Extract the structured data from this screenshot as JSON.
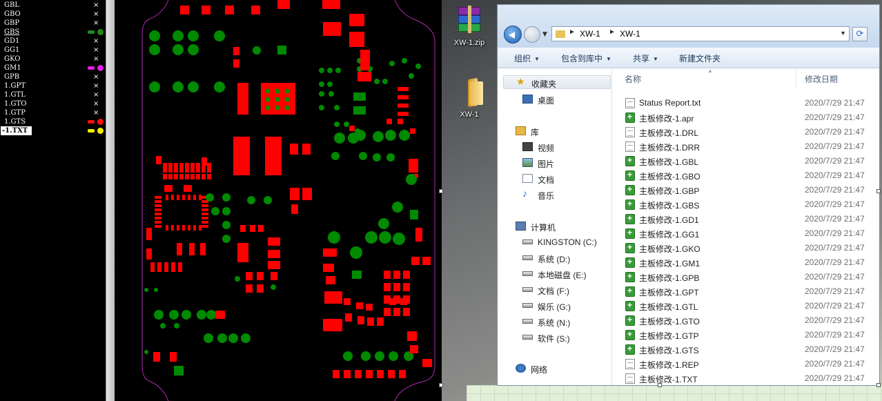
{
  "layer_panel": {
    "layers": [
      {
        "name": "GBL",
        "visible_mark": "×",
        "color": null
      },
      {
        "name": "GBO",
        "visible_mark": "×",
        "color": null
      },
      {
        "name": "GBP",
        "visible_mark": "×",
        "color": null
      },
      {
        "name": "GBS",
        "visible_mark": null,
        "color": "#1d8a1d",
        "underline": true
      },
      {
        "name": "GD1",
        "visible_mark": "×",
        "color": null
      },
      {
        "name": "GG1",
        "visible_mark": "×",
        "color": null
      },
      {
        "name": "GKO",
        "visible_mark": "×",
        "color": null
      },
      {
        "name": "GM1",
        "visible_mark": null,
        "color": "#e020e0"
      },
      {
        "name": "GPB",
        "visible_mark": "×",
        "color": null
      },
      {
        "name": "1.GPT",
        "visible_mark": "×",
        "color": null
      },
      {
        "name": "1.GTL",
        "visible_mark": "×",
        "color": null
      },
      {
        "name": "1.GTO",
        "visible_mark": "×",
        "color": null
      },
      {
        "name": "1.GTP",
        "visible_mark": "×",
        "color": null
      },
      {
        "name": "1.GTS",
        "visible_mark": null,
        "color": "#ff1010"
      },
      {
        "name": "-1.TXT",
        "visible_mark": null,
        "color": "#f3f000",
        "selected": true
      }
    ]
  },
  "pcb": {
    "outline_color": "#b028b0",
    "pad_red": "#ff0000",
    "pad_green": "#008a00"
  },
  "desktop": {
    "icons": [
      {
        "label": "XW-1.zip",
        "icon": "winrar-archive-icon"
      },
      {
        "label": "XW-1",
        "icon": "folder-icon"
      }
    ]
  },
  "explorer": {
    "address": {
      "crumbs": [
        "XW-1",
        "XW-1"
      ]
    },
    "toolbar": {
      "organize": "组织",
      "include_in_library": "包含到库中",
      "share": "共享",
      "new_folder": "新建文件夹"
    },
    "nav": {
      "favorites": "收藏夹",
      "desktop": "桌面",
      "libraries": "库",
      "videos": "视频",
      "pictures": "图片",
      "documents": "文档",
      "music": "音乐",
      "computer": "计算机",
      "drives": [
        "KINGSTON (C:)",
        "系统 (D:)",
        "本地磁盘 (E:)",
        "文档 (F:)",
        "娱乐 (G:)",
        "系统 (N:)",
        "软件 (S:)"
      ],
      "network": "网络"
    },
    "columns": {
      "name": "名称",
      "modified": "修改日期"
    },
    "files": [
      {
        "name": "Status Report.txt",
        "date": "2020/7/29 21:47",
        "icon": "text-file-icon"
      },
      {
        "name": "主板修改-1.apr",
        "date": "2020/7/29 21:47",
        "icon": "gerber-file-icon"
      },
      {
        "name": "主板修改-1.DRL",
        "date": "2020/7/29 21:47",
        "icon": "text-file-icon"
      },
      {
        "name": "主板修改-1.DRR",
        "date": "2020/7/29 21:47",
        "icon": "text-file-icon"
      },
      {
        "name": "主板修改-1.GBL",
        "date": "2020/7/29 21:47",
        "icon": "gerber-file-icon"
      },
      {
        "name": "主板修改-1.GBO",
        "date": "2020/7/29 21:47",
        "icon": "gerber-file-icon"
      },
      {
        "name": "主板修改-1.GBP",
        "date": "2020/7/29 21:47",
        "icon": "gerber-file-icon"
      },
      {
        "name": "主板修改-1.GBS",
        "date": "2020/7/29 21:47",
        "icon": "gerber-file-icon"
      },
      {
        "name": "主板修改-1.GD1",
        "date": "2020/7/29 21:47",
        "icon": "gerber-file-icon"
      },
      {
        "name": "主板修改-1.GG1",
        "date": "2020/7/29 21:47",
        "icon": "gerber-file-icon"
      },
      {
        "name": "主板修改-1.GKO",
        "date": "2020/7/29 21:47",
        "icon": "gerber-file-icon"
      },
      {
        "name": "主板修改-1.GM1",
        "date": "2020/7/29 21:47",
        "icon": "gerber-file-icon"
      },
      {
        "name": "主板修改-1.GPB",
        "date": "2020/7/29 21:47",
        "icon": "gerber-file-icon"
      },
      {
        "name": "主板修改-1.GPT",
        "date": "2020/7/29 21:47",
        "icon": "gerber-file-icon"
      },
      {
        "name": "主板修改-1.GTL",
        "date": "2020/7/29 21:47",
        "icon": "gerber-file-icon"
      },
      {
        "name": "主板修改-1.GTO",
        "date": "2020/7/29 21:47",
        "icon": "gerber-file-icon"
      },
      {
        "name": "主板修改-1.GTP",
        "date": "2020/7/29 21:47",
        "icon": "gerber-file-icon"
      },
      {
        "name": "主板修改-1.GTS",
        "date": "2020/7/29 21:47",
        "icon": "gerber-file-icon"
      },
      {
        "name": "主板修改-1.REP",
        "date": "2020/7/29 21:47",
        "icon": "text-file-icon"
      },
      {
        "name": "主板修改-1.TXT",
        "date": "2020/7/29 21:47",
        "icon": "text-file-icon"
      }
    ]
  }
}
